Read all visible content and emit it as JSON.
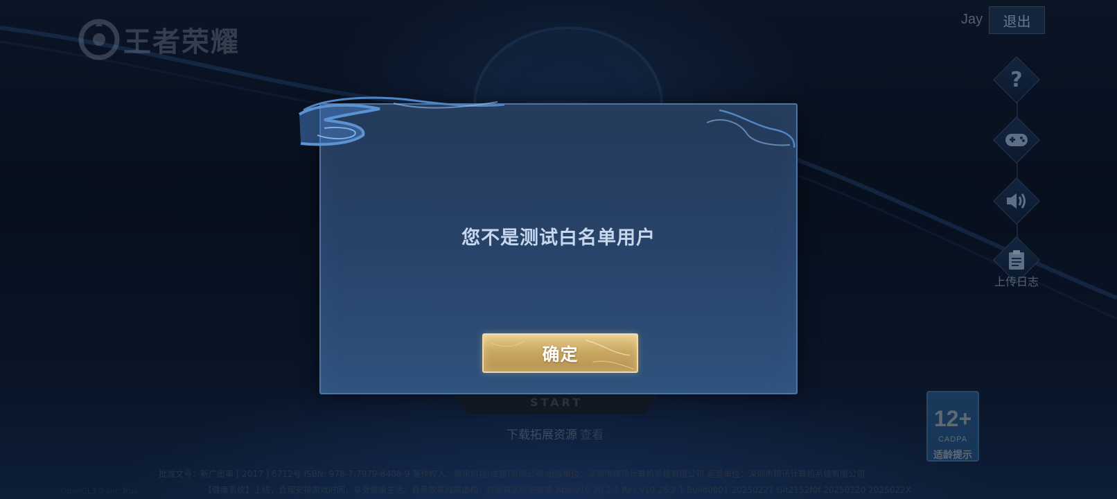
{
  "game": {
    "logo_text": "王者荣耀"
  },
  "account": {
    "user_name": "Jay",
    "logout_label": "退出"
  },
  "side_menu": {
    "help_icon": "question-icon",
    "gamepad_icon": "gamepad-icon",
    "sound_icon": "speaker-icon",
    "upload_log_icon": "clipboard-icon",
    "upload_log_label": "上传日志"
  },
  "start": {
    "label": "START",
    "download_text": "下载拓展资源",
    "download_link": "查看"
  },
  "age_rating": {
    "age": "12+",
    "org": "CADPA",
    "tip": "适龄提示"
  },
  "footer": {
    "line1": "批准文号：新广出审 [ 2017 ] 6712号 ISBN: 978-7-7979-8408-9 著作权人：腾讯科技(成都)有限公司 出版单位：深圳市腾讯计算机系统有限公司 运营单位：深圳市腾讯计算机系统有限公司",
    "line2": "【健康系统】上线，合理安排游戏时间，享受健康生活。背景故事纯属虚构，并非真实历史故事 App:v10.26.2.1 Res:v10.26.2.1 Build0001 20250227 Git2152f0f 20250220 2025022X",
    "corner": "OpenGL3.0 sim:True"
  },
  "dialog": {
    "message": "您不是测试白名单用户",
    "confirm_label": "确定"
  },
  "colors": {
    "modal_bg": "#28436a",
    "modal_border": "#4f75a3",
    "button_gold": "#c9a862",
    "message_text": "#c7d8ee"
  }
}
